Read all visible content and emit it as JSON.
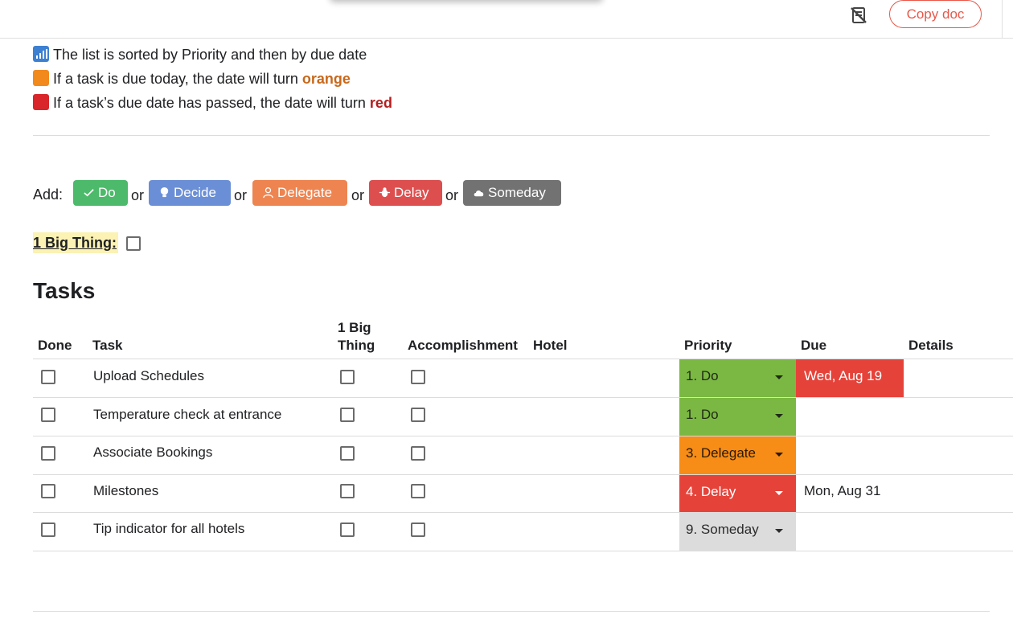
{
  "toolbar": {
    "copy_label": "Copy doc",
    "icons": [
      "no-copy-icon"
    ]
  },
  "notes": [
    {
      "icon": "bar-chart-icon",
      "text": "The list is sorted by Priority and then by due date"
    },
    {
      "icon": "orange-square-icon",
      "text_before": "If a task is due today, the date will turn ",
      "highlight": "orange",
      "color": "#c8681a"
    },
    {
      "icon": "red-square-icon",
      "text_before": "If a task’s due date has passed, the date will turn ",
      "highlight": "red",
      "color": "#b31e1e"
    }
  ],
  "add_bar": {
    "label": "Add:",
    "separator": "or",
    "buttons": [
      {
        "label": "Do",
        "icon": "check-icon",
        "color": "#4cba6a"
      },
      {
        "label": "Decide",
        "icon": "lightbulb-icon",
        "color": "#6b8fd6"
      },
      {
        "label": "Delegate",
        "icon": "person-icon",
        "color": "#ee8450"
      },
      {
        "label": "Delay",
        "icon": "bug-icon",
        "color": "#dd4f4f"
      },
      {
        "label": "Someday",
        "icon": "cloud-icon",
        "color": "#727272"
      }
    ]
  },
  "big_thing": {
    "label": "1 Big Thing:",
    "checked": false
  },
  "tasks": {
    "title": "Tasks",
    "columns": [
      "Done",
      "Task",
      "1 Big Thing",
      "Accomplishment",
      "Hotel",
      "Priority",
      "Due",
      "Details"
    ],
    "column_1big_line1": "1 Big",
    "column_1big_line2": "Thing",
    "rows": [
      {
        "done": false,
        "task": "Upload Schedules",
        "big": false,
        "accomplishment": false,
        "hotel": "",
        "priority": "1. Do",
        "priority_color": "#7bb843",
        "due": "Wed, Aug 19",
        "due_status": "overdue",
        "details": ""
      },
      {
        "done": false,
        "task": "Temperature check at entrance",
        "big": false,
        "accomplishment": false,
        "hotel": "",
        "priority": "1. Do",
        "priority_color": "#7bb843",
        "due": "",
        "due_status": "",
        "details": ""
      },
      {
        "done": false,
        "task": "Associate Bookings",
        "big": false,
        "accomplishment": false,
        "hotel": "",
        "priority": "3. Delegate",
        "priority_color": "#f78c16",
        "due": "",
        "due_status": "",
        "details": ""
      },
      {
        "done": false,
        "task": "Milestones",
        "big": false,
        "accomplishment": false,
        "hotel": "",
        "priority": "4. Delay",
        "priority_color": "#e5433a",
        "due": "Mon, Aug 31",
        "due_status": "normal",
        "details": ""
      },
      {
        "done": false,
        "task": "Tip indicator for all hotels",
        "big": false,
        "accomplishment": false,
        "hotel": "",
        "priority": "9. Someday",
        "priority_color": "#dcdcdc",
        "due": "",
        "due_status": "",
        "details": ""
      }
    ]
  }
}
